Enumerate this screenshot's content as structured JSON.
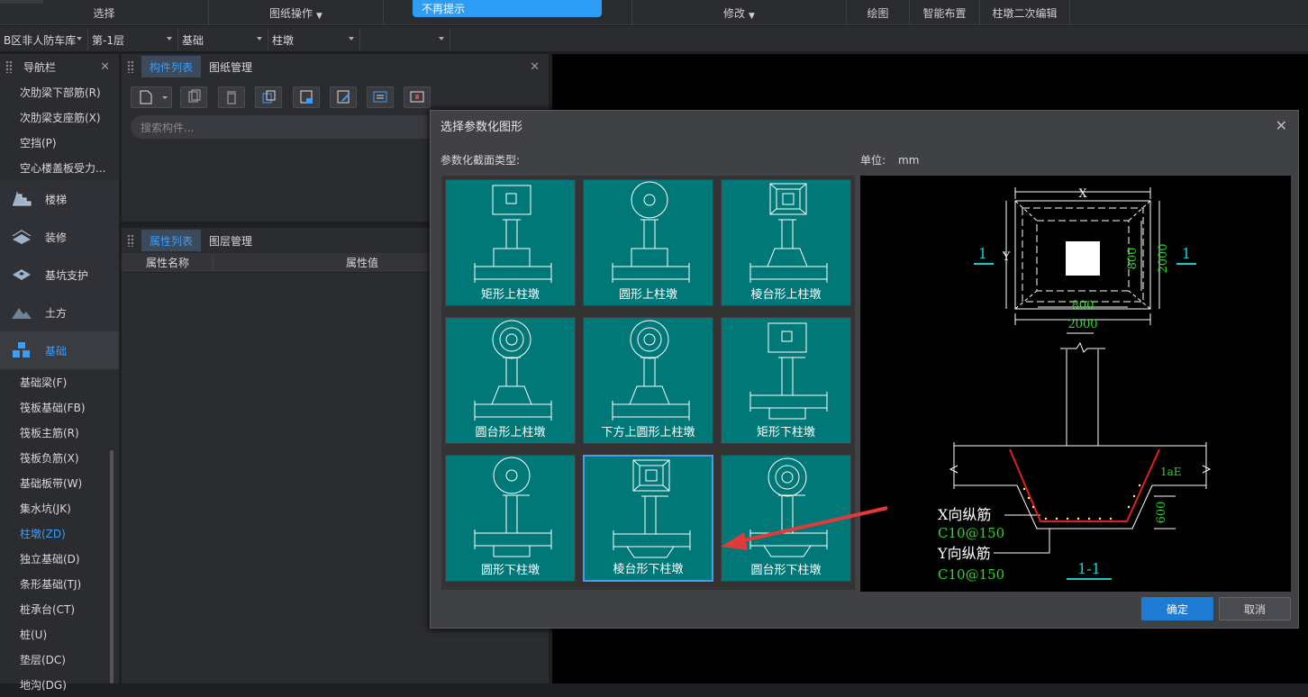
{
  "toolbar": {
    "sections": [
      {
        "label": "选择",
        "dropdown": false
      },
      {
        "label": "图纸操作",
        "dropdown": true
      },
      {
        "label": "修改",
        "dropdown": true
      },
      {
        "label": "绘图",
        "dropdown": false
      },
      {
        "label": "智能布置",
        "dropdown": false
      },
      {
        "label": "柱墩二次编辑",
        "dropdown": false
      }
    ],
    "banner": "不再提示"
  },
  "combos": {
    "area": "B区非人防车库",
    "floor": "第-1层",
    "category": "基础",
    "type": "柱墩",
    "extra": ""
  },
  "nav": {
    "title": "导航栏",
    "top_items": [
      "次肋梁下部筋(R)",
      "次肋梁支座筋(X)",
      "空挡(P)",
      "空心楼盖板受力..."
    ],
    "categories": [
      "楼梯",
      "装修",
      "基坑支护",
      "土方",
      "基础"
    ],
    "selected_category": "基础",
    "items": [
      "基础梁(F)",
      "筏板基础(FB)",
      "筏板主筋(R)",
      "筏板负筋(X)",
      "基础板带(W)",
      "集水坑(JK)",
      "柱墩(ZD)",
      "独立基础(D)",
      "条形基础(TJ)",
      "桩承台(CT)",
      "桩(U)",
      "垫层(DC)",
      "地沟(DG)"
    ],
    "active_item": "柱墩(ZD)"
  },
  "component_panel": {
    "tabs": [
      "构件列表",
      "图纸管理"
    ],
    "active_tab": "构件列表",
    "search_placeholder": "搜索构件..."
  },
  "property_panel": {
    "tabs": [
      "属性列表",
      "图层管理"
    ],
    "active_tab": "属性列表",
    "columns": [
      "属性名称",
      "属性值"
    ]
  },
  "dialog": {
    "title": "选择参数化图形",
    "section_label": "参数化截面类型:",
    "unit_label": "单位:",
    "unit_value": "mm",
    "shapes": [
      "矩形上柱墩",
      "圆形上柱墩",
      "棱台形上柱墩",
      "圆台形上柱墩",
      "下方上圆形上柱墩",
      "矩形下柱墩",
      "圆形下柱墩",
      "棱台形下柱墩",
      "圆台形下柱墩"
    ],
    "selected_shape": "棱台形下柱墩",
    "ok": "确定",
    "cancel": "取消"
  },
  "preview": {
    "dim_x": "X",
    "dim_y": "Y",
    "section_mark": "1",
    "col_size": "800",
    "col_size_h": "800",
    "base_size": "2000",
    "base_size_h": "2000",
    "anchor": "1aE",
    "depth": "600",
    "x_rebar_label": "X向纵筋",
    "x_rebar_value": "C10@150",
    "y_rebar_label": "Y向纵筋",
    "y_rebar_value": "C10@150",
    "section_title": "1-1"
  },
  "colors": {
    "accent": "#3d9cf5",
    "tile": "#007878",
    "ok_button": "#1e7bd4",
    "arrow": "#e03a3a",
    "dim_green": "#2fd72f",
    "label_cyan": "#19c9c9"
  }
}
